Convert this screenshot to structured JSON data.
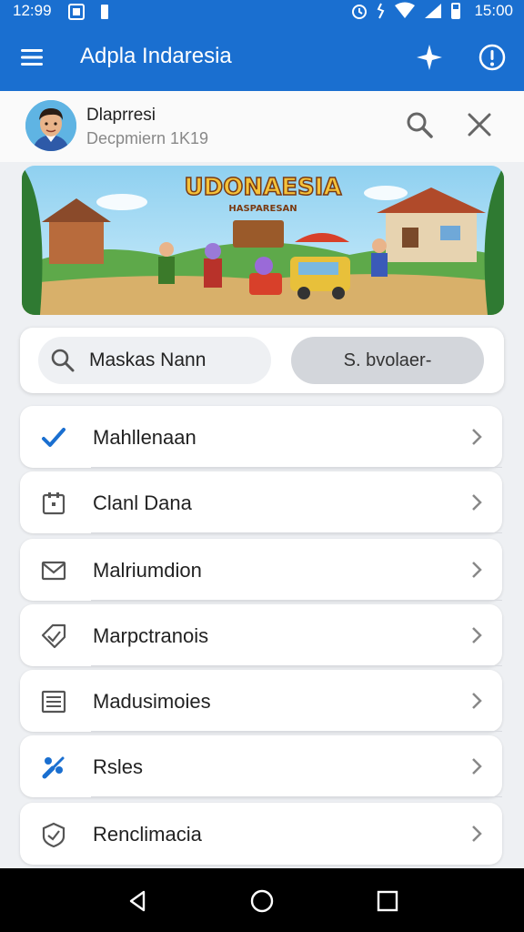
{
  "status": {
    "time": "12:99",
    "clock": "15:00"
  },
  "app_bar": {
    "title": "Adpla Indaresia"
  },
  "profile": {
    "name": "Dlaprresi",
    "subtitle": "Decpmiern 1K19"
  },
  "banner": {
    "title": "UDONAESIA",
    "subtitle": "HASPARESAN"
  },
  "search": {
    "text": "Maskas Nann",
    "button_label": "S. bvolaer-"
  },
  "menu": {
    "items": [
      {
        "label": "Mahllenaan",
        "icon": "check-icon",
        "color": "#1a6fd0"
      },
      {
        "label": "Clanl Dana",
        "icon": "calendar-icon",
        "color": "#555555"
      },
      {
        "label": "Malriumdion",
        "icon": "mail-icon",
        "color": "#555555"
      },
      {
        "label": "Marpctranois",
        "icon": "tag-icon",
        "color": "#555555"
      },
      {
        "label": "Madusimoies",
        "icon": "list-icon",
        "color": "#555555"
      },
      {
        "label": "Rsles",
        "icon": "tools-icon",
        "color": "#1a6fd0"
      },
      {
        "label": "Renclimacia",
        "icon": "badge-icon",
        "color": "#555555"
      }
    ]
  },
  "colors": {
    "primary": "#1a6fd0",
    "background": "#eef0f3",
    "card": "#ffffff"
  }
}
